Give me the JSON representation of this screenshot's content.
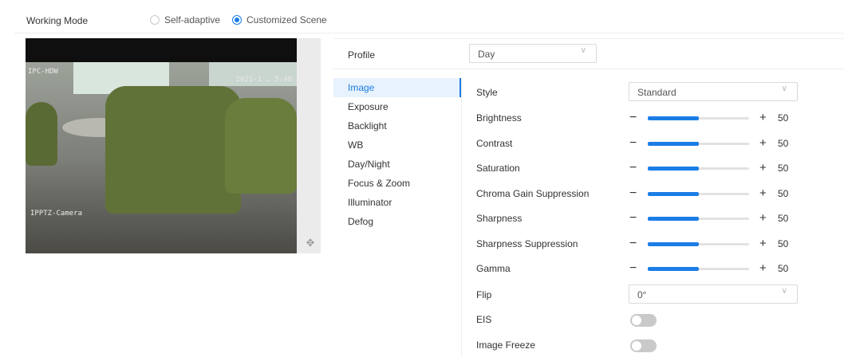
{
  "working_mode": {
    "label": "Working Mode",
    "options": [
      {
        "label": "Self-adaptive",
        "checked": false
      },
      {
        "label": "Customized Scene",
        "checked": true
      }
    ]
  },
  "preview": {
    "osd_top_left": "IPC-HDW",
    "osd_top_right": "2021-1 … 5:40",
    "osd_bottom_left": "IPPTZ-Camera"
  },
  "profile": {
    "label": "Profile",
    "value": "Day"
  },
  "nav": {
    "items": [
      "Image",
      "Exposure",
      "Backlight",
      "WB",
      "Day/Night",
      "Focus & Zoom",
      "Illuminator",
      "Defog"
    ],
    "active": "Image"
  },
  "settings": {
    "style": {
      "label": "Style",
      "value": "Standard"
    },
    "sliders": [
      {
        "label": "Brightness",
        "value": "50",
        "level": 50
      },
      {
        "label": "Contrast",
        "value": "50",
        "level": 50
      },
      {
        "label": "Saturation",
        "value": "50",
        "level": 50
      },
      {
        "label": "Chroma Gain Suppression",
        "value": "50",
        "level": 50
      },
      {
        "label": "Sharpness",
        "value": "50",
        "level": 50
      },
      {
        "label": "Sharpness Suppression",
        "value": "50",
        "level": 50
      },
      {
        "label": "Gamma",
        "value": "50",
        "level": 50
      }
    ],
    "flip": {
      "label": "Flip",
      "value": "0°"
    },
    "eis": {
      "label": "EIS",
      "on": false
    },
    "image_freeze": {
      "label": "Image Freeze",
      "on": false
    }
  },
  "symbols": {
    "minus": "−",
    "plus": "+",
    "chevron": "∨",
    "move": "✥"
  },
  "colors": {
    "accent": "#1b7de6"
  }
}
